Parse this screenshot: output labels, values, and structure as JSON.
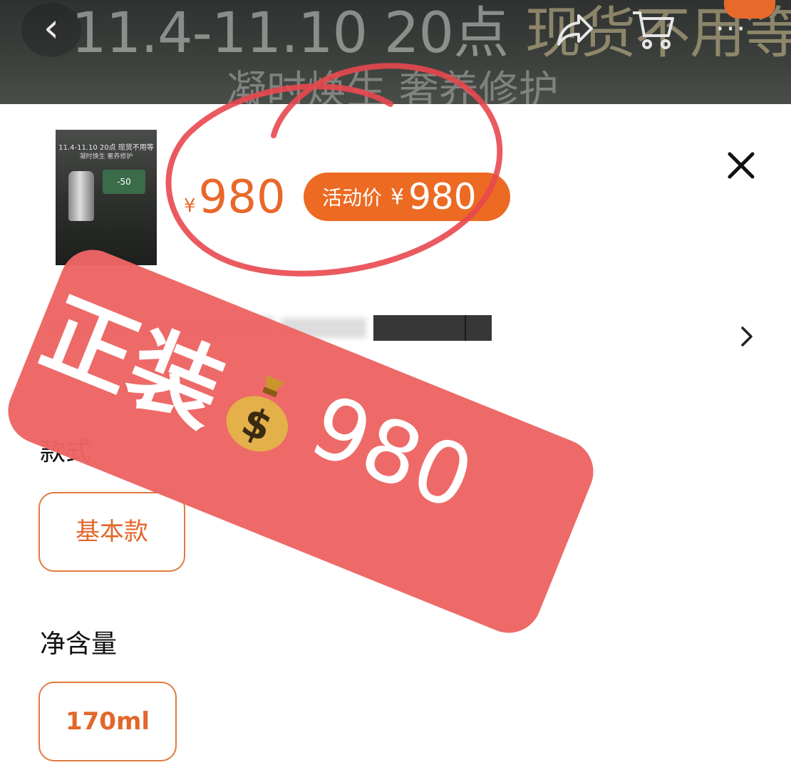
{
  "colors": {
    "accent": "#e8682a",
    "pill": "#ec6a22",
    "sticker": "#ec6563",
    "circle": "#e8484f"
  },
  "banner": {
    "line1_prefix": "11.4-11.10 20点 ",
    "line1_highlight": "现货不用等",
    "line2": "凝时焕生 奢养修护",
    "back_icon": "chevron-left-icon",
    "share_icon": "share-icon",
    "cart_icon": "cart-icon",
    "more_icon": "more-icon",
    "more_glyph": "···"
  },
  "product": {
    "thumb_line1": "11.4-11.10 20点 现货不用等",
    "thumb_line2": "凝时焕生 奢养修护",
    "thumb_badge": "-50",
    "currency": "¥",
    "price": "980",
    "event_label": "活动价",
    "event_currency": "¥",
    "event_price": "980"
  },
  "sections": {
    "style_label": "款式",
    "style_option": "基本款",
    "volume_label": "净含量",
    "volume_option": "170ml"
  },
  "overlay": {
    "sticker_text": "正装",
    "sticker_price": "980",
    "money_icon": "money-bag-icon"
  }
}
